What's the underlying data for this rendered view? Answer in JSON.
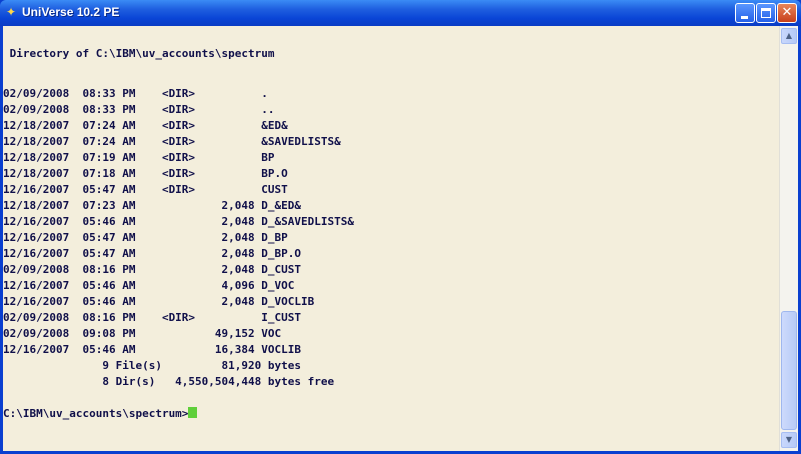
{
  "window": {
    "title": "UniVerse 10.2 PE",
    "min_label": "",
    "max_label": "",
    "close_label": "✕"
  },
  "console": {
    "header": " Directory of C:\\IBM\\uv_accounts\\spectrum",
    "entries": [
      "02/09/2008  08:33 PM    <DIR>          .",
      "02/09/2008  08:33 PM    <DIR>          ..",
      "12/18/2007  07:24 AM    <DIR>          &ED&",
      "12/18/2007  07:24 AM    <DIR>          &SAVEDLISTS&",
      "12/18/2007  07:19 AM    <DIR>          BP",
      "12/18/2007  07:18 AM    <DIR>          BP.O",
      "12/16/2007  05:47 AM    <DIR>          CUST",
      "12/18/2007  07:23 AM             2,048 D_&ED&",
      "12/16/2007  05:46 AM             2,048 D_&SAVEDLISTS&",
      "12/16/2007  05:47 AM             2,048 D_BP",
      "12/16/2007  05:47 AM             2,048 D_BP.O",
      "02/09/2008  08:16 PM             2,048 D_CUST",
      "12/16/2007  05:46 AM             4,096 D_VOC",
      "12/16/2007  05:46 AM             2,048 D_VOCLIB",
      "02/09/2008  08:16 PM    <DIR>          I_CUST",
      "02/09/2008  09:08 PM            49,152 VOC",
      "12/16/2007  05:46 AM            16,384 VOCLIB"
    ],
    "summary_files": "               9 File(s)         81,920 bytes",
    "summary_dirs": "               8 Dir(s)   4,550,504,448 bytes free",
    "prompt": "C:\\IBM\\uv_accounts\\spectrum>"
  },
  "scrollbar": {
    "up_arrow": "▲",
    "down_arrow": "▼"
  }
}
